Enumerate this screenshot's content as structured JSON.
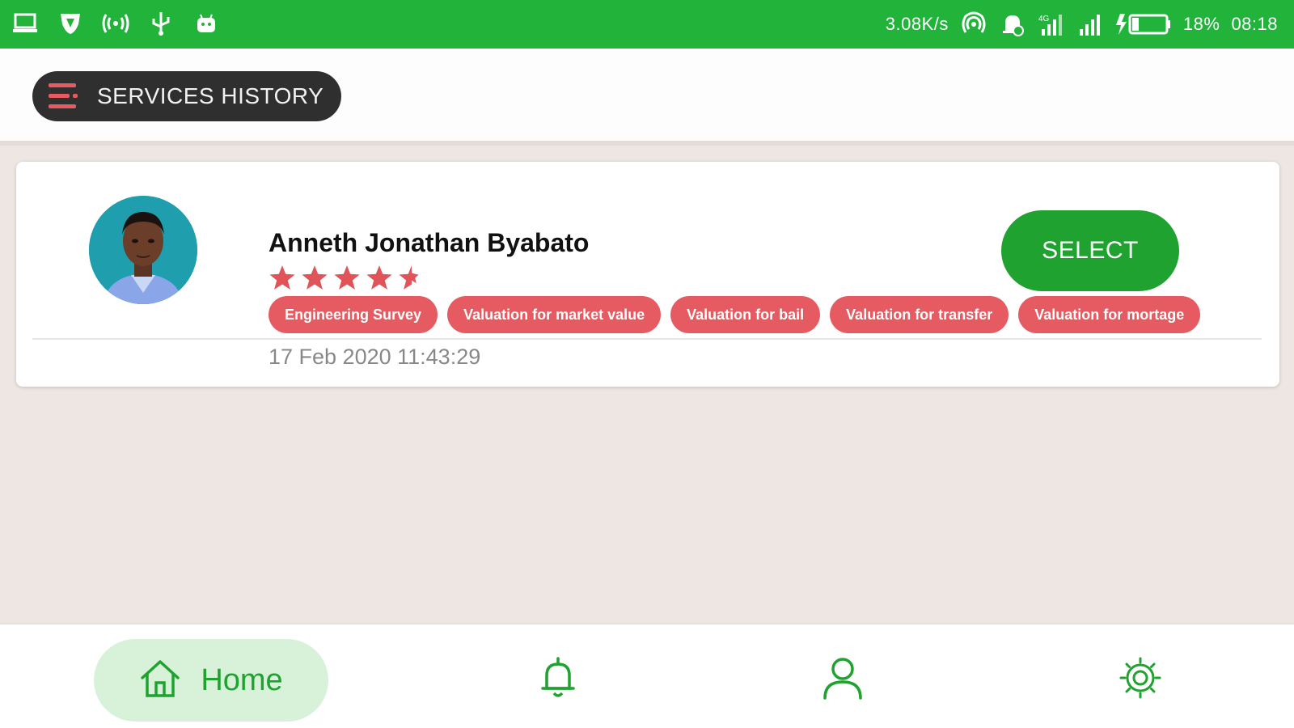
{
  "status_bar": {
    "network_speed": "3.08K/s",
    "battery_percent": "18%",
    "time": "08:18",
    "left_icons": [
      "laptop-icon",
      "shield-icon",
      "hotspot-icon",
      "usb-icon",
      "android-icon"
    ],
    "right_icons": [
      "wifi-icon",
      "notification-bell-icon",
      "signal-4g-icon",
      "signal-icon",
      "battery-charging-icon"
    ],
    "background_color": "#21b33a"
  },
  "header": {
    "title": "SERVICES HISTORY",
    "menu_icon": "menu-icon"
  },
  "service_card": {
    "provider_name": "Anneth Jonathan Byabato",
    "rating": 4.5,
    "rating_max": 5,
    "select_label": "SELECT",
    "tags": [
      "Engineering Survey",
      "Valuation for market value",
      "Valuation for bail",
      "Valuation for transfer",
      "Valuation for mortage"
    ],
    "datetime": "17 Feb 2020 11:43:29"
  },
  "bottom_nav": {
    "items": [
      {
        "label": "Home",
        "icon": "home-icon",
        "active": true
      },
      {
        "label": "",
        "icon": "bell-icon",
        "active": false
      },
      {
        "label": "",
        "icon": "user-icon",
        "active": false
      },
      {
        "label": "",
        "icon": "settings-icon",
        "active": false
      }
    ]
  },
  "colors": {
    "accent_green": "#1fa22f",
    "tag_red": "#e55b61",
    "star_red": "#e05358",
    "header_pill": "#2f2f2f"
  }
}
